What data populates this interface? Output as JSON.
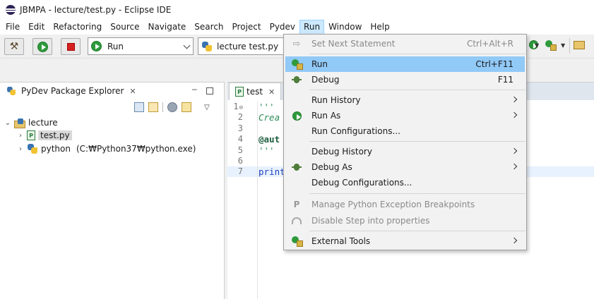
{
  "window": {
    "title": "JBMPA - lecture/test.py - Eclipse IDE"
  },
  "menubar": {
    "items": [
      "File",
      "Edit",
      "Refactoring",
      "Source",
      "Navigate",
      "Search",
      "Project",
      "Pydev",
      "Run",
      "Window",
      "Help"
    ]
  },
  "toolbar": {
    "launch_mode": "Run",
    "launch_config": "lecture test.py"
  },
  "left_panel": {
    "title": "PyDev Package Explorer",
    "tree": {
      "project": "lecture",
      "file": "test.py",
      "interpreter": "python",
      "interpreter_path": "(C:₩Python37₩python.exe)"
    }
  },
  "editor": {
    "tab": "test",
    "line_numbers": [
      "1",
      "2",
      "3",
      "4",
      "5",
      "6",
      "7"
    ],
    "fold_marker": "⊖",
    "lines": [
      "'''",
      "Crea",
      "",
      "@aut",
      "'''",
      "",
      "print"
    ]
  },
  "run_menu": {
    "items": [
      {
        "label": "Set Next Statement",
        "shortcut": "Ctrl+Alt+R",
        "disabled": true,
        "icon": "arrow-right-icon"
      },
      {
        "label": "Run",
        "shortcut": "Ctrl+F11",
        "highlighted": true,
        "icon": "run-icon"
      },
      {
        "label": "Debug",
        "shortcut": "F11",
        "icon": "debug-icon"
      },
      {
        "label": "Run History",
        "submenu": true
      },
      {
        "label": "Run As",
        "submenu": true,
        "icon": "run-as-icon"
      },
      {
        "label": "Run Configurations..."
      },
      {
        "label": "Debug History",
        "submenu": true
      },
      {
        "label": "Debug As",
        "submenu": true,
        "icon": "bug-icon"
      },
      {
        "label": "Debug Configurations..."
      },
      {
        "label": "Manage Python Exception Breakpoints",
        "disabled": true,
        "icon": "p-breakpoint-icon"
      },
      {
        "label": "Disable Step into properties",
        "disabled": true,
        "icon": "step-icon"
      },
      {
        "label": "External Tools",
        "submenu": true,
        "icon": "external-tools-icon"
      }
    ]
  },
  "colors": {
    "menu_highlight": "#91c9f7",
    "active_menu": "#cce8ff",
    "run_green": "#2e9a3c",
    "stop_red": "#d42020"
  }
}
